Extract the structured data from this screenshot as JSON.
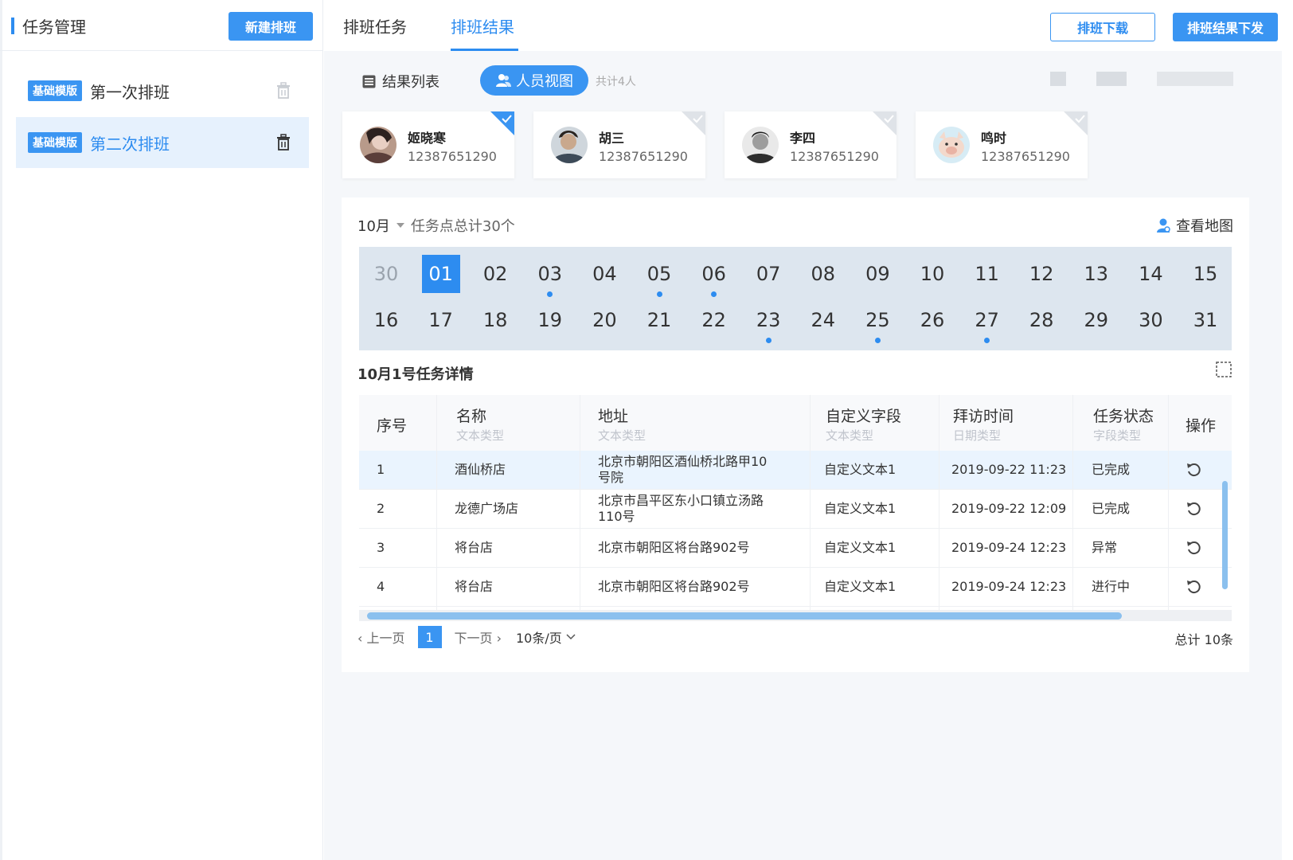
{
  "sidebar": {
    "title": "任务管理",
    "new_button": "新建排班",
    "items": [
      {
        "tag": "基础模版",
        "name": "第一次排班",
        "active": false
      },
      {
        "tag": "基础模版",
        "name": "第二次排班",
        "active": true
      }
    ]
  },
  "topbar": {
    "tabs": [
      {
        "label": "排班任务",
        "active": false
      },
      {
        "label": "排班结果",
        "active": true
      }
    ],
    "download_button": "排班下载",
    "issue_button": "排班结果下发"
  },
  "view": {
    "list_label": "结果列表",
    "person_label": "人员视图",
    "total_people": "共计4人"
  },
  "persons": [
    {
      "name": "姬晓寒",
      "phone": "12387651290",
      "selected": true
    },
    {
      "name": "胡三",
      "phone": "12387651290",
      "selected": false
    },
    {
      "name": "李四",
      "phone": "12387651290",
      "selected": false
    },
    {
      "name": "鸣时",
      "phone": "12387651290",
      "selected": false
    }
  ],
  "calendar": {
    "month": "10月",
    "task_total": "任务点总计30个",
    "view_map": "查看地图",
    "row1": [
      "30",
      "01",
      "02",
      "03",
      "04",
      "05",
      "06",
      "07",
      "08",
      "09",
      "10",
      "11",
      "12",
      "13",
      "14",
      "15"
    ],
    "row2": [
      "16",
      "17",
      "18",
      "19",
      "20",
      "21",
      "22",
      "23",
      "24",
      "25",
      "26",
      "27",
      "28",
      "29",
      "30",
      "31"
    ],
    "selected": "01",
    "muted": [
      "30"
    ],
    "dots_row1": [
      "03",
      "05",
      "06"
    ],
    "dots_row2": [
      "23",
      "25",
      "27"
    ]
  },
  "detail": {
    "title": "10月1号任务详情",
    "columns": [
      {
        "label": "序号",
        "sub": ""
      },
      {
        "label": "名称",
        "sub": "文本类型"
      },
      {
        "label": "地址",
        "sub": "文本类型"
      },
      {
        "label": "自定义字段",
        "sub": "文本类型"
      },
      {
        "label": "拜访时间",
        "sub": "日期类型"
      },
      {
        "label": "任务状态",
        "sub": "字段类型"
      },
      {
        "label": "操作",
        "sub": ""
      }
    ],
    "rows": [
      {
        "no": "1",
        "name": "酒仙桥店",
        "addr1": "北京市朝阳区酒仙桥北路甲10",
        "addr2": "号院",
        "custom": "自定义文本1",
        "time": "2019-09-22 11:23",
        "status": "已完成"
      },
      {
        "no": "2",
        "name": "龙德广场店",
        "addr1": "北京市昌平区东小口镇立汤路",
        "addr2": "110号",
        "custom": "自定义文本1",
        "time": "2019-09-22 12:09",
        "status": "已完成"
      },
      {
        "no": "3",
        "name": "将台店",
        "addr1": "北京市朝阳区将台路902号",
        "addr2": "",
        "custom": "自定义文本1",
        "time": "2019-09-24 12:23",
        "status": "异常"
      },
      {
        "no": "4",
        "name": "将台店",
        "addr1": "北京市朝阳区将台路902号",
        "addr2": "",
        "custom": "自定义文本1",
        "time": "2019-09-24 12:23",
        "status": "进行中"
      }
    ]
  },
  "pager": {
    "prev": "上一页",
    "current": "1",
    "next": "下一页",
    "page_size": "10条/页",
    "total": "总计 10条"
  },
  "colors": {
    "accent": "#2d8cf0",
    "accent_btn": "#3a95f2",
    "calendar_bg": "#dde6ef"
  }
}
